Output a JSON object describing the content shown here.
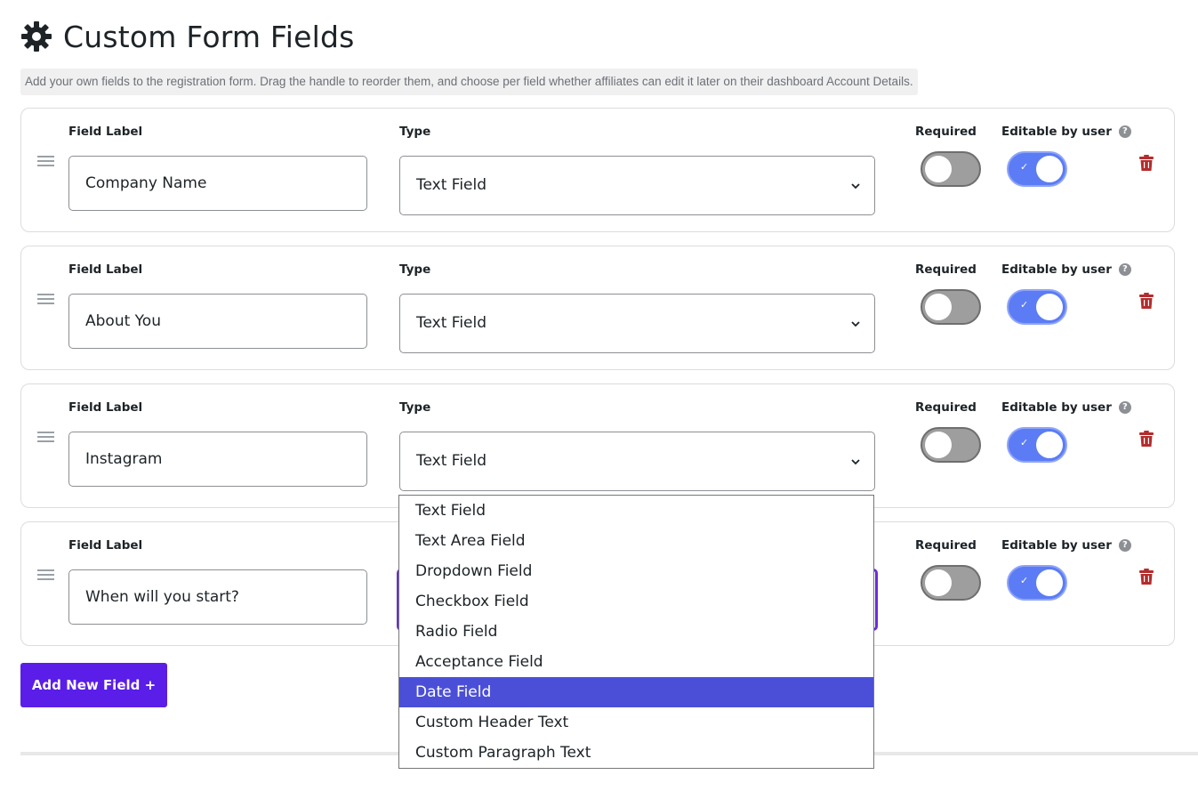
{
  "header": {
    "title": "Custom Form Fields",
    "description": "Add your own fields to the registration form. Drag the handle to reorder them, and choose per field whether affiliates can edit it later on their dashboard Account Details."
  },
  "labels": {
    "field_label": "Field Label",
    "type": "Type",
    "required": "Required",
    "editable": "Editable by user",
    "help": "?"
  },
  "fields": [
    {
      "label": "Company Name",
      "type": "Text Field",
      "required": false,
      "editable": true
    },
    {
      "label": "About You",
      "type": "Text Field",
      "required": false,
      "editable": true
    },
    {
      "label": "Instagram",
      "type": "Text Field",
      "required": false,
      "editable": true
    },
    {
      "label": "When will you start?",
      "type": "",
      "required": false,
      "editable": true
    }
  ],
  "dropdown": {
    "options": [
      "Text Field",
      "Text Area Field",
      "Dropdown Field",
      "Checkbox Field",
      "Radio Field",
      "Acceptance Field",
      "Date Field",
      "Custom Header Text",
      "Custom Paragraph Text"
    ],
    "selected": "Date Field"
  },
  "add_button": "Add New Field +",
  "colors": {
    "accent": "#5a1ee8",
    "toggle_on": "#5b7cf5",
    "toggle_off": "#9e9e9e",
    "trash": "#b32d2e",
    "selected_option": "#4b4fd8"
  }
}
